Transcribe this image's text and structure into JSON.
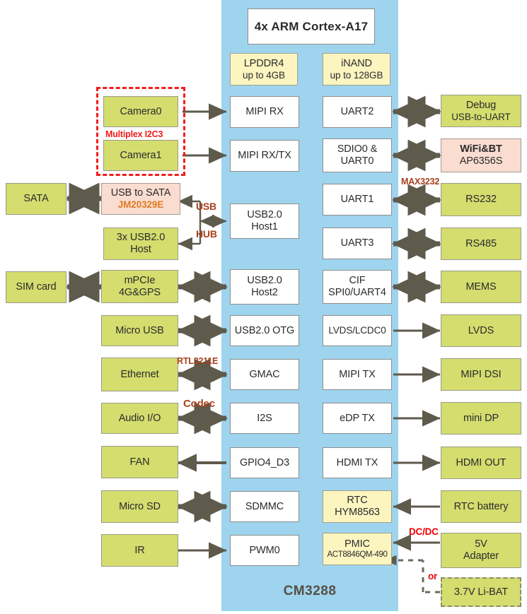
{
  "diagram": {
    "soc_name": "CM3288",
    "cpu": {
      "label": "4x ARM Cortex-A17"
    },
    "memory": [
      {
        "name": "lpddr4",
        "line1": "LPDDR4",
        "line2": "up to 4GB"
      },
      {
        "name": "inand",
        "line1": "iNAND",
        "line2": "up to 128GB"
      }
    ],
    "soc_left_blocks": [
      {
        "name": "mipi-rx",
        "line1": "MIPI RX",
        "line2": ""
      },
      {
        "name": "mipi-rx-tx",
        "line1": "MIPI RX/TX",
        "line2": ""
      },
      {
        "name": "usb20-host1",
        "line1": "USB2.0",
        "line2": "Host1"
      },
      {
        "name": "usb20-host2",
        "line1": "USB2.0",
        "line2": "Host2"
      },
      {
        "name": "usb20-otg",
        "line1": "USB2.0 OTG",
        "line2": ""
      },
      {
        "name": "gmac",
        "line1": "GMAC",
        "line2": ""
      },
      {
        "name": "i2s",
        "line1": "I2S",
        "line2": ""
      },
      {
        "name": "gpio4-d3",
        "line1": "GPIO4_D3",
        "line2": ""
      },
      {
        "name": "sdmmc",
        "line1": "SDMMC",
        "line2": ""
      },
      {
        "name": "pwm0",
        "line1": "PWM0",
        "line2": ""
      }
    ],
    "soc_right_blocks": [
      {
        "name": "uart2",
        "line1": "UART2",
        "line2": ""
      },
      {
        "name": "sdio0-uart0",
        "line1": "SDIO0 &",
        "line2": "UART0"
      },
      {
        "name": "uart1",
        "line1": "UART1",
        "line2": ""
      },
      {
        "name": "uart3",
        "line1": "UART3",
        "line2": ""
      },
      {
        "name": "cif-spi0-uart4",
        "line1": "CIF",
        "line2": "SPI0/UART4"
      },
      {
        "name": "lvds-lcdc0",
        "line1": "LVDS/LCDC0",
        "line2": ""
      },
      {
        "name": "mipi-tx",
        "line1": "MIPI TX",
        "line2": ""
      },
      {
        "name": "edp-tx",
        "line1": "eDP TX",
        "line2": ""
      },
      {
        "name": "hdmi-tx",
        "line1": "HDMI TX",
        "line2": ""
      },
      {
        "name": "rtc",
        "line1": "RTC",
        "line2": "HYM8563"
      },
      {
        "name": "pmic",
        "line1": "PMIC",
        "line2": "ACT8846QM-490"
      }
    ],
    "left_blocks": [
      {
        "name": "camera0",
        "line1": "Camera0",
        "line2": ""
      },
      {
        "name": "camera1",
        "line1": "Camera1",
        "line2": ""
      },
      {
        "name": "usb-to-sata",
        "line1": "USB to SATA",
        "line2": "JM20329E"
      },
      {
        "name": "3x-usb20-host",
        "line1": "3x USB2.0",
        "line2": "Host"
      },
      {
        "name": "mpcie",
        "line1": "mPCIe",
        "line2": "4G&GPS"
      },
      {
        "name": "micro-usb",
        "line1": "Micro USB",
        "line2": ""
      },
      {
        "name": "ethernet",
        "line1": "Ethernet",
        "line2": ""
      },
      {
        "name": "audio-io",
        "line1": "Audio I/O",
        "line2": ""
      },
      {
        "name": "fan",
        "line1": "FAN",
        "line2": ""
      },
      {
        "name": "micro-sd",
        "line1": "Micro SD",
        "line2": ""
      },
      {
        "name": "ir",
        "line1": "IR",
        "line2": ""
      }
    ],
    "far_left_blocks": [
      {
        "name": "sata",
        "line1": "SATA",
        "line2": ""
      },
      {
        "name": "sim-card",
        "line1": "SIM card",
        "line2": ""
      }
    ],
    "right_blocks": [
      {
        "name": "debug-usb-to-uart",
        "line1": "Debug",
        "line2": "USB-to-UART"
      },
      {
        "name": "wifi-bt",
        "line1": "WiFi&BT",
        "line2": "AP6356S"
      },
      {
        "name": "rs232",
        "line1": "RS232",
        "line2": ""
      },
      {
        "name": "rs485",
        "line1": "RS485",
        "line2": ""
      },
      {
        "name": "mems",
        "line1": "MEMS",
        "line2": ""
      },
      {
        "name": "lvds",
        "line1": "LVDS",
        "line2": ""
      },
      {
        "name": "mipi-dsi",
        "line1": "MIPI DSI",
        "line2": ""
      },
      {
        "name": "mini-dp",
        "line1": "mini DP",
        "line2": ""
      },
      {
        "name": "hdmi-out",
        "line1": "HDMI OUT",
        "line2": ""
      },
      {
        "name": "rtc-battery",
        "line1": "RTC battery",
        "line2": ""
      },
      {
        "name": "5v-adapter",
        "line1": "5V",
        "line2": "Adapter"
      },
      {
        "name": "li-bat",
        "line1": "3.7V Li-BAT",
        "line2": ""
      }
    ],
    "annotations": [
      {
        "name": "multiplex-i2c3",
        "text": "Multiplex I2C3"
      },
      {
        "name": "usb-label",
        "text": "USB"
      },
      {
        "name": "hub-label",
        "text": "HUB"
      },
      {
        "name": "max3232-label",
        "text": "MAX3232"
      },
      {
        "name": "rtl8211e-label",
        "text": "RTL8211E"
      },
      {
        "name": "codec-label",
        "text": "Codec"
      },
      {
        "name": "dcdc-label",
        "text": "DC/DC"
      },
      {
        "name": "or-label",
        "text": "or"
      }
    ],
    "colors": {
      "soc_blue": "#9fd4ee",
      "peripheral_green": "#d4dd6e",
      "memory_yellow": "#fdf5c0",
      "chip_pink": "#fadcd0",
      "accent_red": "#ef1b1b",
      "accent_brown": "#a8401c",
      "arrow_gray": "#5e5a4c"
    }
  }
}
